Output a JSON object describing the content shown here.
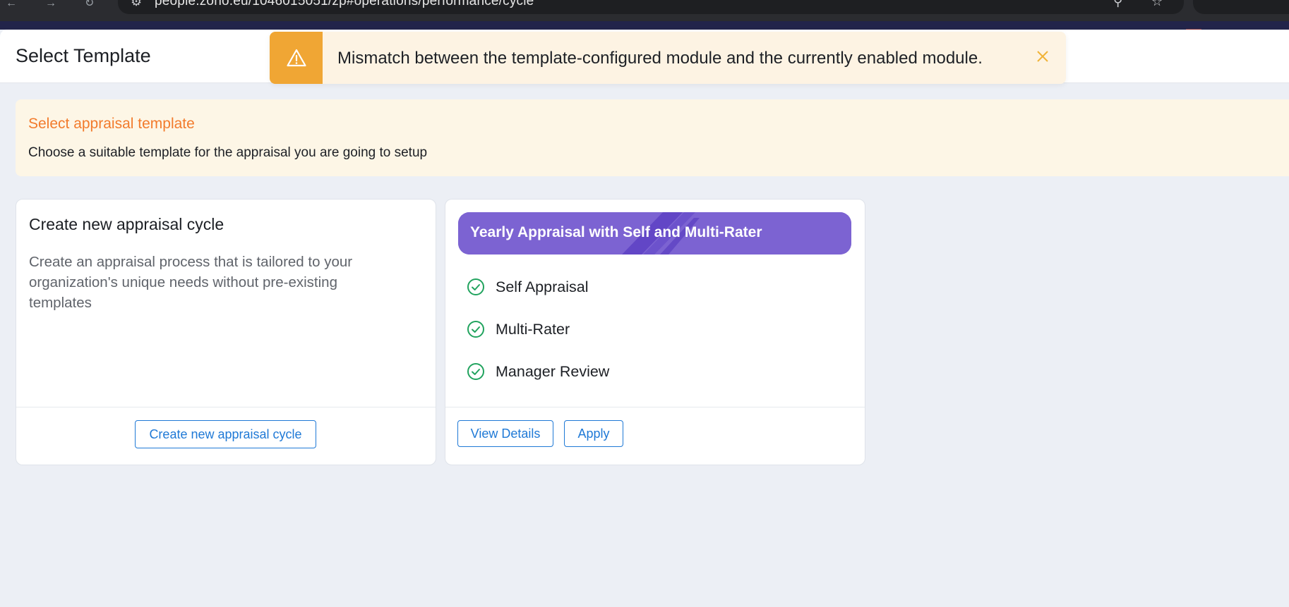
{
  "browser": {
    "address": "people.zoho.eu/1046015051/zp#operations/performance/cycle"
  },
  "header": {
    "title": "Select Template"
  },
  "toast": {
    "icon": "warning-triangle-icon",
    "message": "Mismatch between the template-configured module and the currently enabled module.",
    "close_icon": "close-icon",
    "accent_color": "#f0a634",
    "background_color": "#fdf3e3"
  },
  "info_banner": {
    "title": "Select appraisal template",
    "description": "Choose a suitable template for the appraisal you are going to setup",
    "title_color": "#f27b2c"
  },
  "cards": {
    "create_new": {
      "title": "Create new appraisal cycle",
      "description": "Create an appraisal process that is tailored to your organization's unique needs without pre-existing templates",
      "button_label": "Create new appraisal cycle"
    },
    "template": {
      "name": "Yearly Appraisal with Self and Multi-Rater",
      "banner_color": "#7c63d2",
      "features": [
        {
          "label": "Self Appraisal",
          "icon": "check-circle-icon"
        },
        {
          "label": "Multi-Rater",
          "icon": "check-circle-icon"
        },
        {
          "label": "Manager Review",
          "icon": "check-circle-icon"
        }
      ],
      "view_details_label": "View Details",
      "apply_label": "Apply"
    }
  },
  "colors": {
    "primary_link": "#1f79d6",
    "check_green": "#21a35e",
    "page_background": "#eceff5"
  }
}
